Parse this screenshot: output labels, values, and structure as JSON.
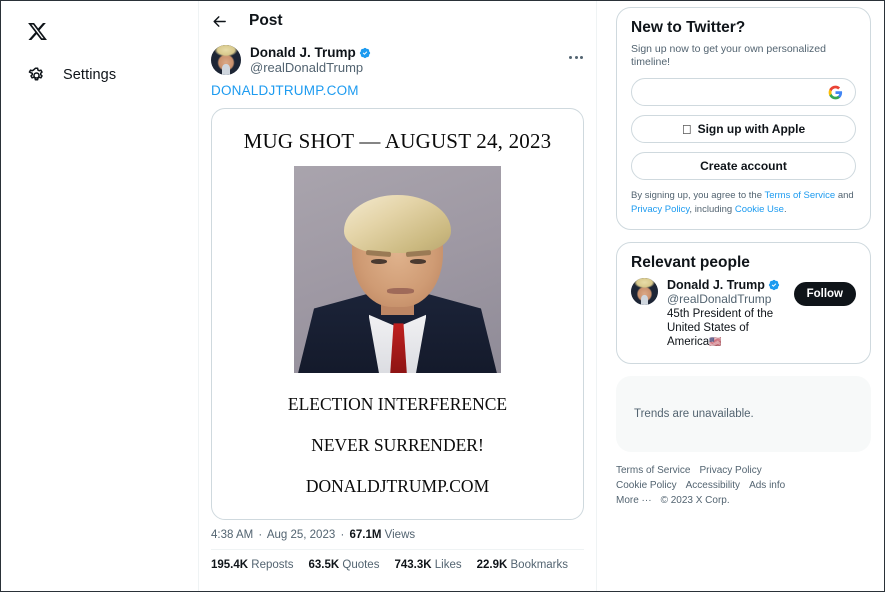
{
  "sidebar": {
    "logo_icon": "x-logo-icon",
    "items": [
      {
        "label": "Settings",
        "icon": "gear-icon"
      }
    ]
  },
  "center": {
    "back_icon": "back-arrow-icon",
    "header_title": "Post",
    "author": {
      "name": "Donald J. Trump",
      "handle": "@realDonaldTrump",
      "verified_icon": "verified-badge-icon",
      "avatar_name": "avatar"
    },
    "more_icon": "more-options-icon",
    "post_link": "DONALDJTRUMP.COM",
    "media_card": {
      "title": "MUG SHOT — AUGUST 24, 2023",
      "image_alt": "mugshot-photo",
      "line1": "ELECTION INTERFERENCE",
      "line2": "NEVER SURRENDER!",
      "line3": "DONALDJTRUMP.COM"
    },
    "meta": {
      "time": "4:38 AM",
      "date": "Aug 25, 2023",
      "views_count": "67.1M",
      "views_label": "Views",
      "separator": "·"
    },
    "stats": [
      {
        "count": "195.4K",
        "label": "Reposts"
      },
      {
        "count": "63.5K",
        "label": "Quotes"
      },
      {
        "count": "743.3K",
        "label": "Likes"
      },
      {
        "count": "22.9K",
        "label": "Bookmarks"
      }
    ]
  },
  "right": {
    "signup": {
      "title": "New to Twitter?",
      "subtitle": "Sign up now to get your own personalized timeline!",
      "google_button_label": "",
      "google_icon": "google-g-icon",
      "apple_button_label": "Sign up with Apple",
      "apple_icon": "apple-logo-icon",
      "create_account_label": "Create account",
      "legal_prefix": "By signing up, you agree to the ",
      "legal_tos": "Terms of Service",
      "legal_and": " and ",
      "legal_privacy": "Privacy Policy",
      "legal_including": ", including ",
      "legal_cookie": "Cookie Use",
      "legal_suffix": "."
    },
    "relevant_people": {
      "title": "Relevant people",
      "person": {
        "name": "Donald J. Trump",
        "handle": "@realDonaldTrump",
        "bio": "45th President of the United States of America",
        "bio_flag": "🇺🇸",
        "verified_icon": "verified-badge-icon",
        "follow_label": "Follow"
      }
    },
    "trends": {
      "message": "Trends are unavailable."
    },
    "footer": [
      "Terms of Service",
      "Privacy Policy",
      "Cookie Policy",
      "Accessibility",
      "Ads info",
      "More ···"
    ],
    "copyright": "© 2023 X Corp."
  },
  "colors": {
    "link": "#1d9bf0",
    "text": "#0f1419",
    "muted": "#536471",
    "border": "#cfd9de",
    "divider": "#eff3f4",
    "follow_bg": "#0f1419",
    "trends_bg": "#f7f9f9"
  }
}
